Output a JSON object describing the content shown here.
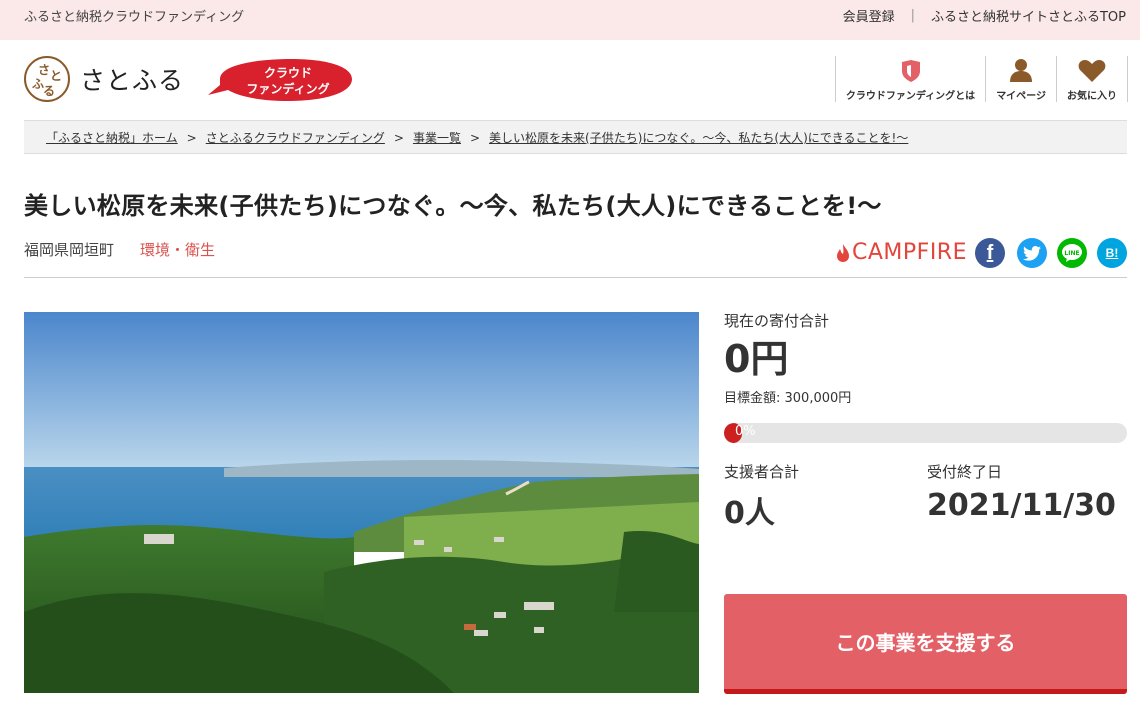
{
  "topbar": {
    "site_name": "ふるさと納税クラウドファンディング",
    "register": "会員登録",
    "separator": "|",
    "top_link": "ふるさと納税サイトさとふるTOP"
  },
  "header": {
    "logo_text": "さとふる",
    "logo_mark_chars": [
      "さ",
      "と",
      "ふ",
      "る"
    ],
    "badge_line1": "クラウド",
    "badge_line2": "ファンディング",
    "nav": [
      {
        "label": "クラウドファンディングとは",
        "icon": "shield-icon"
      },
      {
        "label": "マイページ",
        "icon": "user-icon"
      },
      {
        "label": "お気に入り",
        "icon": "heart-icon"
      }
    ]
  },
  "breadcrumb": {
    "items": [
      "「ふるさと納税」ホーム",
      "さとふるクラウドファンディング",
      "事業一覧",
      "美しい松原を未来(子供たち)につなぐ。～今、私たち(大人)にできることを!～"
    ],
    "separator": ">"
  },
  "project": {
    "title": "美しい松原を未来(子供たち)につなぐ。～今、私たち(大人)にできることを!～",
    "location": "福岡県岡垣町",
    "category": "環境・衛生",
    "partner": "CAMPFIRE",
    "share": {
      "facebook": "f",
      "line": "LINE",
      "hatena": "B!"
    }
  },
  "stats": {
    "total_label": "現在の寄付合計",
    "total_value": "0円",
    "goal_text": "目標金額: 300,000円",
    "progress_percent": 0,
    "progress_text": "0%",
    "supporters_label": "支援者合計",
    "supporters_value": "0人",
    "deadline_label": "受付終了日",
    "deadline_value": "2021/11/30"
  },
  "cta": {
    "label": "この事業を支援する"
  },
  "colors": {
    "accent": "#e36067",
    "topbar_bg": "#fbe8e8",
    "brand_brown": "#8b5a2b",
    "campfire_red": "#e2453b"
  }
}
